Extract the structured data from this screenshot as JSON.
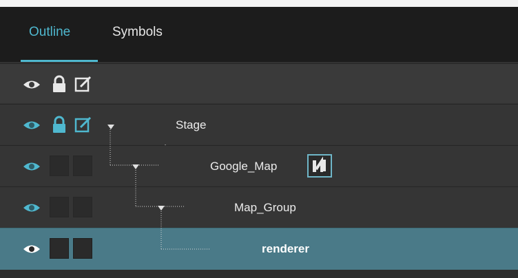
{
  "tabs": [
    {
      "label": "Outline",
      "active": true
    },
    {
      "label": "Symbols",
      "active": false
    }
  ],
  "colors": {
    "accent": "#4fb8cf",
    "selected_row": "#4a7a88",
    "panel": "#353535",
    "tabbar": "#1c1c1c"
  },
  "header_row": {
    "icons": [
      "eye-icon",
      "lock-icon",
      "edit-icon"
    ]
  },
  "layers": [
    {
      "name": "Stage",
      "depth": 0,
      "expanded": true,
      "eye": true,
      "lock": true,
      "edit": true,
      "selected": false
    },
    {
      "name": "Google_Map",
      "depth": 1,
      "expanded": true,
      "eye": true,
      "lock": false,
      "edit": false,
      "selected": false,
      "badge": "symbol-icon"
    },
    {
      "name": "Map_Group",
      "depth": 2,
      "expanded": true,
      "eye": true,
      "lock": false,
      "edit": false,
      "selected": false
    },
    {
      "name": "renderer",
      "depth": 3,
      "expanded": false,
      "eye": true,
      "lock": false,
      "edit": false,
      "selected": true
    }
  ]
}
